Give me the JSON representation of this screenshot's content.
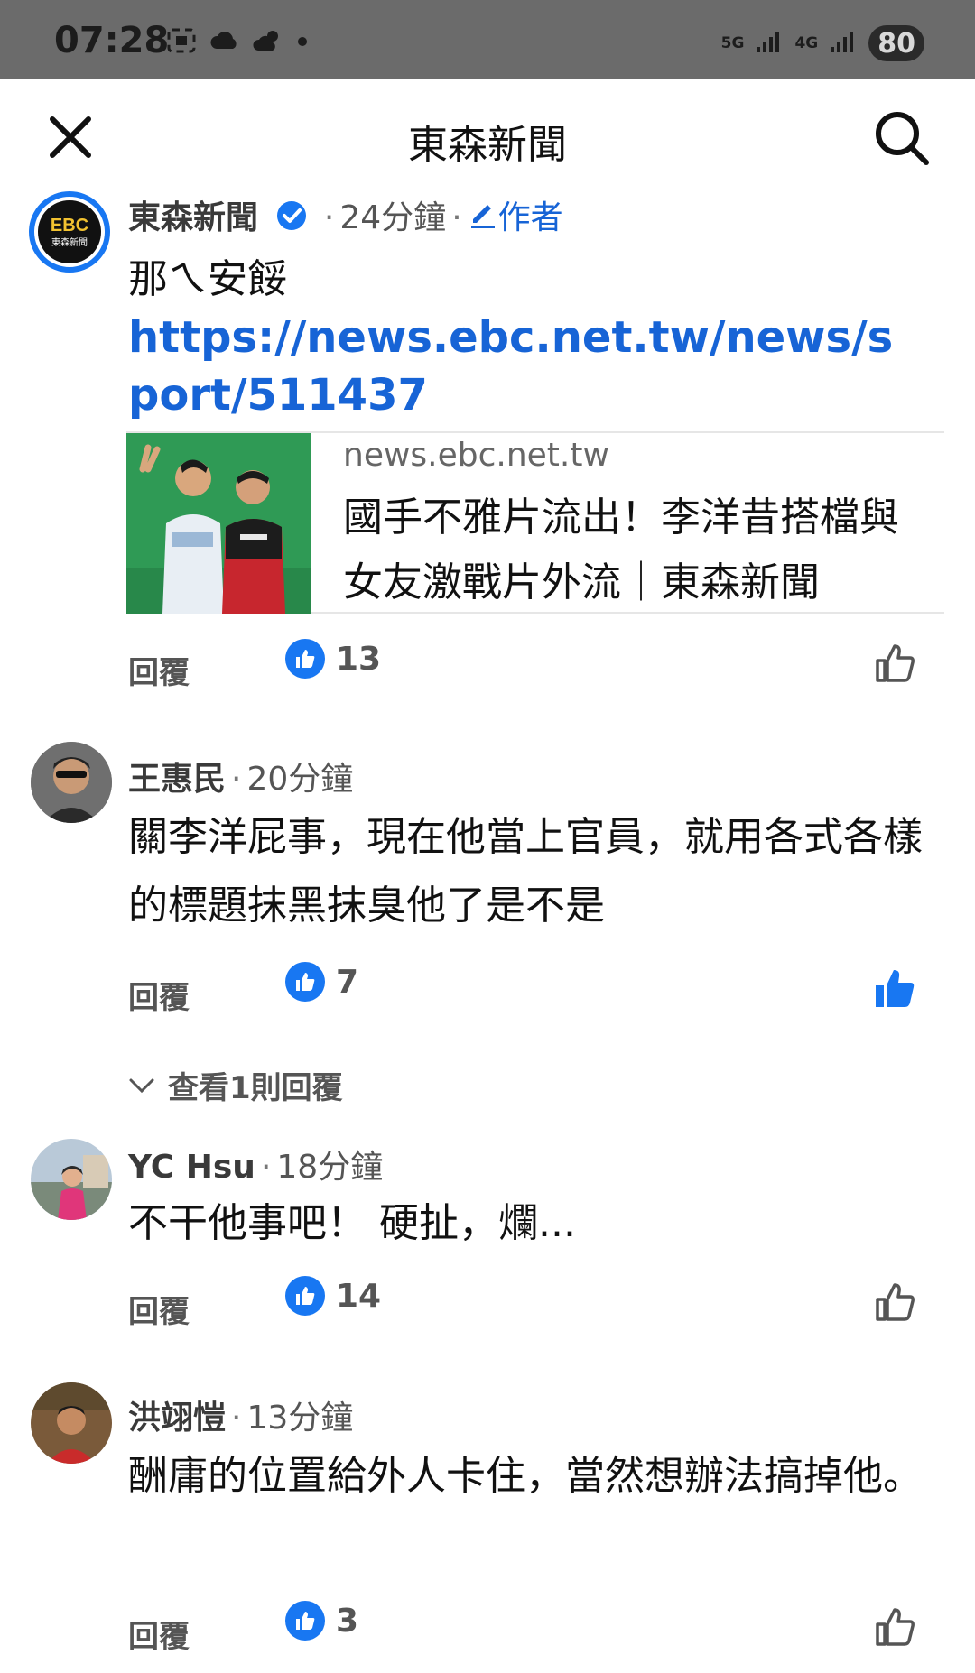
{
  "status_bar": {
    "time": "07:28",
    "network_1": "5G",
    "network_2": "4G",
    "battery": "80"
  },
  "header": {
    "title": "東森新聞"
  },
  "post": {
    "author": "東森新聞",
    "time": "24分鐘",
    "author_tag": "作者",
    "text": "那ㄟ安餒",
    "link": "https://news.ebc.net.tw/news/sport/511437",
    "preview_domain": "news.ebc.net.tw",
    "preview_title": "國手不雅片流出！李洋昔搭檔與女友激戰片外流｜東森新聞",
    "reply_label": "回覆",
    "likes": "13",
    "avatar_logo_line1": "EBC",
    "avatar_logo_line2": "東森新聞"
  },
  "comments": [
    {
      "author": "王惠民",
      "time": "20分鐘",
      "text": "關李洋屁事，現在他當上官員，就用各式各樣的標題抹黑抹臭他了是不是",
      "reply_label": "回覆",
      "likes": "7",
      "liked": true
    },
    {
      "author": "YC Hsu",
      "time": "18分鐘",
      "text": "不干他事吧！ 硬扯，爛...",
      "reply_label": "回覆",
      "likes": "14",
      "liked": false
    },
    {
      "author": "洪翊愷",
      "time": "13分鐘",
      "text": "酬庸的位置給外人卡住，當然想辦法搞掉他。",
      "reply_label": "回覆",
      "likes": "3",
      "liked": false
    }
  ],
  "view_replies": "查看1則回覆",
  "colors": {
    "accent": "#1877f2",
    "link": "#1764d6",
    "status_bar": "#6b6b6b"
  }
}
